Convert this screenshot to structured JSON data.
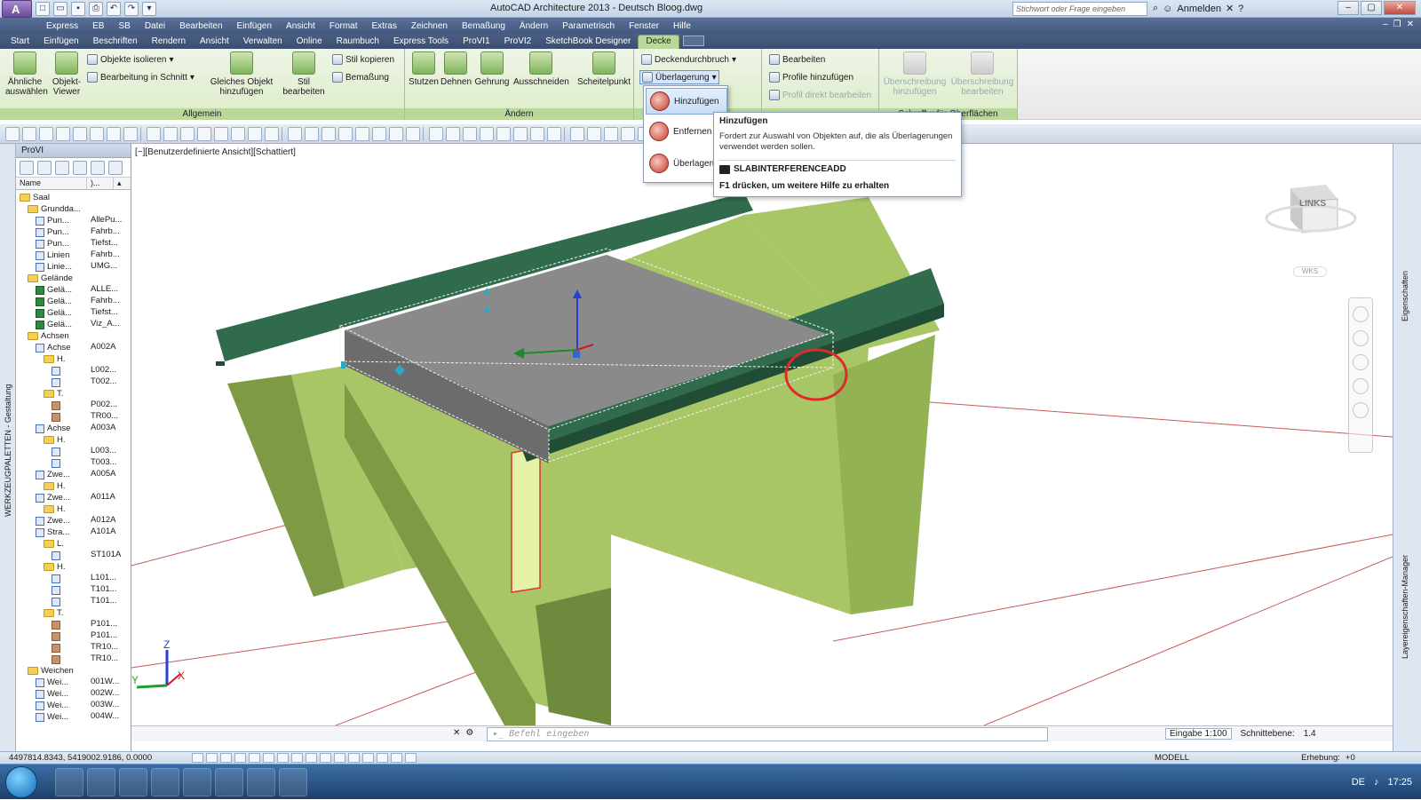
{
  "title_bar": {
    "window_title": "AutoCAD Architecture 2013 - Deutsch    Bloog.dwg",
    "search_placeholder": "Stichwort oder Frage eingeben",
    "sign_in": "Anmelden",
    "app_letter": "A",
    "qat_icons": [
      "new-icon",
      "open-icon",
      "save-icon",
      "print-icon",
      "undo-icon",
      "redo-icon",
      "more-icon"
    ]
  },
  "menubar": [
    "Express",
    "EB",
    "SB",
    "Datei",
    "Bearbeiten",
    "Einfügen",
    "Ansicht",
    "Format",
    "Extras",
    "Zeichnen",
    "Bemaßung",
    "Ändern",
    "Parametrisch",
    "Fenster",
    "Hilfe"
  ],
  "ribbon_tabs": [
    "Start",
    "Einfügen",
    "Beschriften",
    "Rendern",
    "Ansicht",
    "Verwalten",
    "Online",
    "Raumbuch",
    "Express Tools",
    "ProVI1",
    "ProVI2",
    "SketchBook Designer",
    "Decke"
  ],
  "active_tab": "Decke",
  "ribbon": {
    "allgemein": {
      "title": "Allgemein",
      "aehnliche": "Ähnliche\nauswählen",
      "objekt_viewer": "Objekt-\nViewer",
      "objekte_isolieren": "Objekte isolieren",
      "bearbeitung_schnitt": "Bearbeitung in Schnitt",
      "gleiches_objekt": "Gleiches Objekt\nhinzufügen",
      "stil_bearbeiten": "Stil\nbearbeiten",
      "stil_kopieren": "Stil kopieren",
      "bemassung": "Bemaßung"
    },
    "aendern": {
      "title": "Ändern",
      "stutzen": "Stutzen",
      "dehnen": "Dehnen",
      "gehrung": "Gehrung",
      "ausschneiden": "Ausschneiden",
      "scheitelpunkt": "Scheitelpunkt"
    },
    "decke_group": {
      "deckendurchbruch": "Deckendurchbruch",
      "ueberlagerung": "Überlagerung"
    },
    "kanten": {
      "bearbeiten": "Bearbeiten",
      "profile_hinzufuegen": "Profile hinzufügen",
      "profil_direkt": "Profil direkt bearbeiten"
    },
    "oberflaechen": {
      "title": "Schraffur für Oberflächen",
      "ueberschreibung_hinzufuegen": "Überschreibung\nhinzufügen",
      "ueberschreibung_bearbeiten": "Überschreibung\nbearbeiten"
    }
  },
  "dropdown": {
    "items": [
      "Hinzufügen",
      "Entfernen",
      "Überlageru"
    ],
    "highlighted": "Hinzufügen"
  },
  "tooltip": {
    "title": "Hinzufügen",
    "description": "Fordert zur Auswahl von Objekten auf, die als Überlagerungen verwendet werden sollen.",
    "command": "SLABINTERFERENCEADD",
    "help": "F1 drücken, um weitere Hilfe zu erhalten"
  },
  "palette": {
    "title": "ProVI",
    "columns": [
      "Name",
      ")..."
    ],
    "side_label": "WERKZEUGPALETTEN - Gestaltung",
    "tree": [
      {
        "n": "Saal",
        "v": "",
        "lvl": 0,
        "t": "folder"
      },
      {
        "n": "Grundda...",
        "v": "",
        "lvl": 1,
        "t": "folder"
      },
      {
        "n": "Pun...",
        "v": "AllePu...",
        "lvl": 2,
        "t": "icon"
      },
      {
        "n": "Pun...",
        "v": "Fahrb...",
        "lvl": 2,
        "t": "icon"
      },
      {
        "n": "Pun...",
        "v": "Tiefst...",
        "lvl": 2,
        "t": "icon"
      },
      {
        "n": "Linien",
        "v": "Fahrb...",
        "lvl": 2,
        "t": "icon"
      },
      {
        "n": "Linie...",
        "v": "UMG...",
        "lvl": 2,
        "t": "icon"
      },
      {
        "n": "Gelände",
        "v": "",
        "lvl": 1,
        "t": "folder"
      },
      {
        "n": "Gelä...",
        "v": "ALLE...",
        "lvl": 2,
        "t": "green"
      },
      {
        "n": "Gelä...",
        "v": "Fahrb...",
        "lvl": 2,
        "t": "green"
      },
      {
        "n": "Gelä...",
        "v": "Tiefst...",
        "lvl": 2,
        "t": "green"
      },
      {
        "n": "Gelä...",
        "v": "Viz_A...",
        "lvl": 2,
        "t": "green"
      },
      {
        "n": "Achsen",
        "v": "",
        "lvl": 1,
        "t": "folder"
      },
      {
        "n": "Achse",
        "v": "A002A",
        "lvl": 2,
        "t": "icon"
      },
      {
        "n": "H.",
        "v": "",
        "lvl": 3,
        "t": "folder"
      },
      {
        "n": "",
        "v": "L002...",
        "lvl": 4,
        "t": "icon"
      },
      {
        "n": "",
        "v": "T002...",
        "lvl": 4,
        "t": "icon"
      },
      {
        "n": "T.",
        "v": "",
        "lvl": 3,
        "t": "folder"
      },
      {
        "n": "",
        "v": "P002...",
        "lvl": 4,
        "t": "brown"
      },
      {
        "n": "",
        "v": "TR00...",
        "lvl": 4,
        "t": "brown"
      },
      {
        "n": "Achse",
        "v": "A003A",
        "lvl": 2,
        "t": "icon"
      },
      {
        "n": "H.",
        "v": "",
        "lvl": 3,
        "t": "folder"
      },
      {
        "n": "",
        "v": "L003...",
        "lvl": 4,
        "t": "icon"
      },
      {
        "n": "",
        "v": "T003...",
        "lvl": 4,
        "t": "icon"
      },
      {
        "n": "Zwe...",
        "v": "A005A",
        "lvl": 2,
        "t": "icon"
      },
      {
        "n": "H.",
        "v": "",
        "lvl": 3,
        "t": "folder"
      },
      {
        "n": "Zwe...",
        "v": "A011A",
        "lvl": 2,
        "t": "icon"
      },
      {
        "n": "H.",
        "v": "",
        "lvl": 3,
        "t": "folder"
      },
      {
        "n": "Zwe...",
        "v": "A012A",
        "lvl": 2,
        "t": "icon"
      },
      {
        "n": "Stra...",
        "v": "A101A",
        "lvl": 2,
        "t": "icon"
      },
      {
        "n": "L.",
        "v": "",
        "lvl": 3,
        "t": "folder"
      },
      {
        "n": "",
        "v": "ST101A",
        "lvl": 4,
        "t": "icon"
      },
      {
        "n": "H.",
        "v": "",
        "lvl": 3,
        "t": "folder"
      },
      {
        "n": "",
        "v": "L101...",
        "lvl": 4,
        "t": "icon"
      },
      {
        "n": "",
        "v": "T101...",
        "lvl": 4,
        "t": "icon"
      },
      {
        "n": "",
        "v": "T101...",
        "lvl": 4,
        "t": "icon"
      },
      {
        "n": "T.",
        "v": "",
        "lvl": 3,
        "t": "folder"
      },
      {
        "n": "",
        "v": "P101...",
        "lvl": 4,
        "t": "brown"
      },
      {
        "n": "",
        "v": "P101...",
        "lvl": 4,
        "t": "brown"
      },
      {
        "n": "",
        "v": "TR10...",
        "lvl": 4,
        "t": "brown"
      },
      {
        "n": "",
        "v": "TR10...",
        "lvl": 4,
        "t": "brown"
      },
      {
        "n": "Weichen",
        "v": "",
        "lvl": 1,
        "t": "folder"
      },
      {
        "n": "Wei...",
        "v": "001W...",
        "lvl": 2,
        "t": "icon"
      },
      {
        "n": "Wei...",
        "v": "002W...",
        "lvl": 2,
        "t": "icon"
      },
      {
        "n": "Wei...",
        "v": "003W...",
        "lvl": 2,
        "t": "icon"
      },
      {
        "n": "Wei...",
        "v": "004W...",
        "lvl": 2,
        "t": "icon"
      }
    ]
  },
  "viewport": {
    "label": "[−][Benutzerdefinierte Ansicht][Schattiert]",
    "viewcube": "LINKS",
    "wcs": "WKS",
    "right_labels": [
      "Eigenschaften",
      "Layereigenschaften-Manager"
    ],
    "colors": {
      "concrete": "#a9c667",
      "concrete_dark": "#6e8a3c",
      "beam": "#2f6b4c",
      "beam_dark": "#214d37",
      "slab": "#8a8a8a",
      "highlight": "#e02a2a"
    }
  },
  "command_line": {
    "placeholder": "Befehl eingeben",
    "scale": "Eingabe 1:100",
    "schnittebene": "Schnittebene:",
    "schnittebene_val": "1.4"
  },
  "status_bar": {
    "coords": "4497814.8343, 5419002.9186, 0.0000",
    "modell": "MODELL",
    "erhebung": "Erhebung:",
    "erhebung_val": "+0"
  },
  "taskbar": {
    "lang": "DE",
    "time": "17:25"
  }
}
